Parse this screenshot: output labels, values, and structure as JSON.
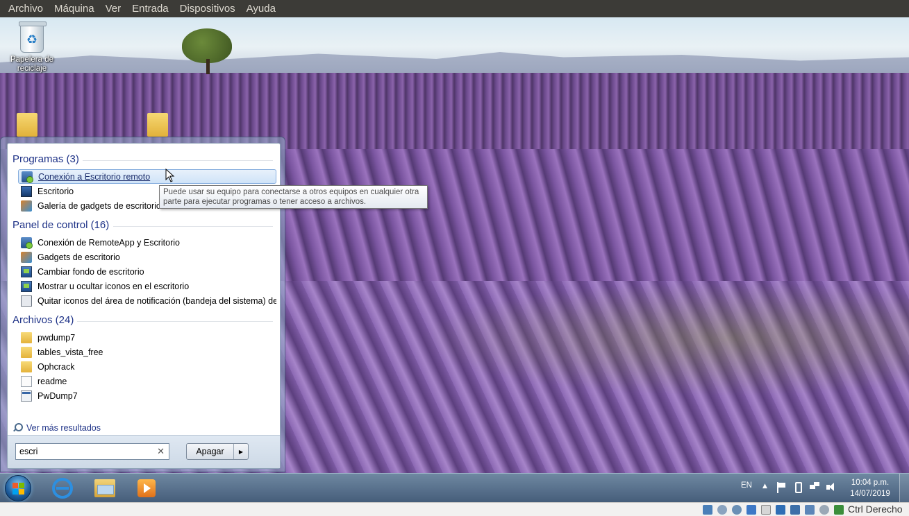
{
  "vbox_menu": [
    "Archivo",
    "Máquina",
    "Ver",
    "Entrada",
    "Dispositivos",
    "Ayuda"
  ],
  "desktop": {
    "recycle_bin_label": "Papelera de reciclaje"
  },
  "start_menu": {
    "groups": [
      {
        "title": "Programas (3)",
        "items": [
          {
            "label": "Conexión a Escritorio remoto",
            "icon": "remote-desktop-icon",
            "highlighted": true
          },
          {
            "label": "Escritorio",
            "icon": "desktop-icon"
          },
          {
            "label": "Galería de gadgets de escritorio",
            "icon": "gadgets-gallery-icon"
          }
        ]
      },
      {
        "title": "Panel de control (16)",
        "items": [
          {
            "label": "Conexión de RemoteApp y Escritorio",
            "icon": "remoteapp-icon"
          },
          {
            "label": "Gadgets de escritorio",
            "icon": "gadgets-icon"
          },
          {
            "label": "Cambiar fondo de escritorio",
            "icon": "control-panel-icon"
          },
          {
            "label": "Mostrar u ocultar iconos en el escritorio",
            "icon": "control-panel-icon"
          },
          {
            "label": "Quitar iconos del área de notificación (bandeja del sistema) del ...",
            "icon": "notification-area-icon"
          }
        ]
      },
      {
        "title": "Archivos (24)",
        "items": [
          {
            "label": "pwdump7",
            "icon": "folder-icon"
          },
          {
            "label": "tables_vista_free",
            "icon": "folder-icon"
          },
          {
            "label": "Ophcrack",
            "icon": "folder-icon"
          },
          {
            "label": "readme",
            "icon": "text-document-icon"
          },
          {
            "label": "PwDump7",
            "icon": "executable-icon"
          }
        ]
      }
    ],
    "more_results": "Ver más resultados",
    "search_value": "escri",
    "shutdown_label": "Apagar"
  },
  "tooltip": {
    "line1": "Puede usar su equipo para conectarse a otros equipos en cualquier otra",
    "line2": "parte para ejecutar programas o tener acceso a archivos."
  },
  "taskbar": {
    "language": "EN",
    "time": "10:04 p.m.",
    "date": "14/07/2019"
  },
  "vbox_status": {
    "host_key": "Ctrl Derecho"
  }
}
